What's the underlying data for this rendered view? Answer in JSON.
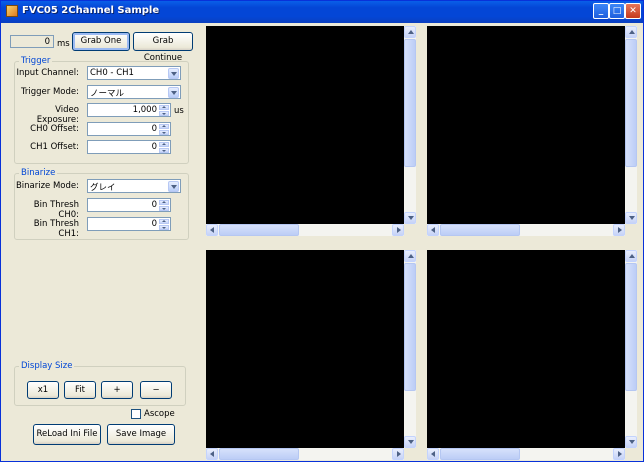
{
  "window": {
    "title": "FVC05 2Channel Sample"
  },
  "top": {
    "time_value": "0",
    "time_unit": "ms",
    "grab_one": "Grab One",
    "grab_continue": "Grab Continue"
  },
  "trigger": {
    "title": "Trigger",
    "input_channel_label": "Input Channel:",
    "input_channel_value": "CH0 - CH1",
    "trigger_mode_label": "Trigger Mode:",
    "trigger_mode_value": "ノーマル",
    "video_exposure_label": "Video Exposure:",
    "video_exposure_value": "1,000",
    "video_exposure_unit": "us",
    "ch0_offset_label": "CH0 Offset:",
    "ch0_offset_value": "0",
    "ch1_offset_label": "CH1 Offset:",
    "ch1_offset_value": "0"
  },
  "binarize": {
    "title": "Binarize",
    "mode_label": "Binarize Mode:",
    "mode_value": "グレイ",
    "thresh_ch0_label": "Bin Thresh CH0:",
    "thresh_ch0_value": "0",
    "thresh_ch1_label": "Bin Thresh CH1:",
    "thresh_ch1_value": "0"
  },
  "display_size": {
    "title": "Display Size",
    "x1": "x1",
    "fit": "Fit",
    "plus": "+",
    "minus": "−"
  },
  "ascope": {
    "label": "Ascope",
    "checked": false
  },
  "bottom": {
    "reload": "ReLoad Ini File",
    "save": "Save Image"
  },
  "colors": {
    "title_bar": "#0446d6",
    "viewer": "#000000",
    "group_title": "#0046d5"
  },
  "icons": [
    "app-icon",
    "minimize-icon",
    "maximize-icon",
    "close-icon"
  ]
}
